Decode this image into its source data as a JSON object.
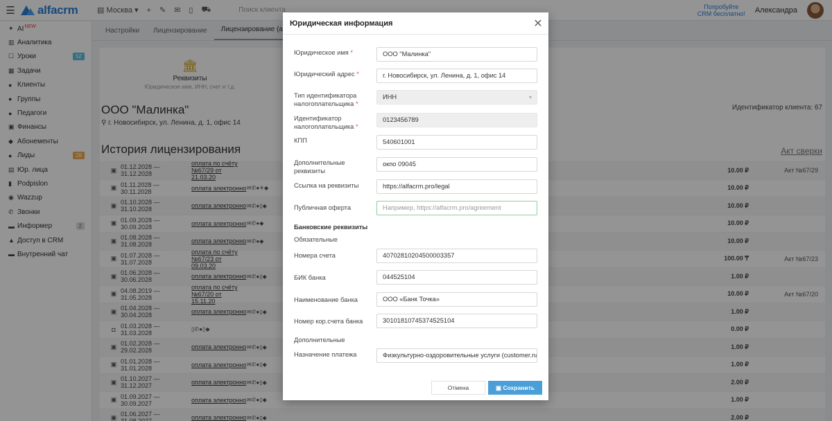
{
  "topbar": {
    "logo": "alfacrm",
    "city": "Москва",
    "search_placeholder": "Поиск клиента",
    "promo_line1": "Попробуйте",
    "promo_line2": "CRM бесплатно!",
    "user_name": "Александра"
  },
  "sidebar": {
    "items": [
      {
        "icon": "ai-icon",
        "label": "AI",
        "badge": "NEW"
      },
      {
        "icon": "analytics-icon",
        "label": "Аналитика"
      },
      {
        "icon": "lessons-icon",
        "label": "Уроки",
        "badge": "52"
      },
      {
        "icon": "tasks-icon",
        "label": "Задачи"
      },
      {
        "icon": "clients-icon",
        "label": "Клиенты"
      },
      {
        "icon": "groups-icon",
        "label": "Группы"
      },
      {
        "icon": "teachers-icon",
        "label": "Педагоги"
      },
      {
        "icon": "finance-icon",
        "label": "Финансы"
      },
      {
        "icon": "subscriptions-icon",
        "label": "Абонементы"
      },
      {
        "icon": "leads-icon",
        "label": "Лиды",
        "badge": "28"
      },
      {
        "icon": "legal-icon",
        "label": "Юр. лица"
      },
      {
        "icon": "podpislon-icon",
        "label": "Podpislon"
      },
      {
        "icon": "wazzup-icon",
        "label": "Wazzup"
      },
      {
        "icon": "calls-icon",
        "label": "Звонки"
      },
      {
        "icon": "informer-icon",
        "label": "Информер",
        "badge": "2"
      },
      {
        "icon": "lock-icon",
        "label": "Доступ в CRM"
      },
      {
        "icon": "chat-icon",
        "label": "Внутренний чат"
      }
    ]
  },
  "tabs": [
    "Настройки",
    "Лицензирование",
    "Лицензирование (архив)"
  ],
  "requisites": {
    "title": "Реквизиты",
    "subtitle": "Юридическое имя, ИНН, счет и т.д."
  },
  "org": {
    "name": "ООО \"Малинка\"",
    "address": "г. Новосибирск, ул. Ленина, д. 1, офис 14",
    "client_id": "Идентификатор клиента: 67"
  },
  "history": {
    "title": "История лицензирования",
    "act_link": "Акт сверки",
    "rows": [
      {
        "period": "01.12.2028 — 31.12.2028",
        "pay": "оплата по счёту №67/29 от 21.03.20",
        "amount": "10.00 ₽",
        "act": "Акт №67/29"
      },
      {
        "period": "01.11.2028 — 30.11.2028",
        "pay": "оплата электронно",
        "amount": "10.00 ₽",
        "act": ""
      },
      {
        "period": "01.10.2028 — 31.10.2028",
        "pay": "оплата электронно",
        "amount": "10.00 ₽",
        "act": ""
      },
      {
        "period": "01.09.2028 — 30.09.2028",
        "pay": "оплата электронно",
        "amount": "10.00 ₽",
        "act": ""
      },
      {
        "period": "01.08.2028 — 31.08.2028",
        "pay": "оплата электронно",
        "amount": "10.00 ₽",
        "act": ""
      },
      {
        "period": "01.07.2028 — 31.07.2028",
        "pay": "оплата по счёту №67/23 от 09.03.20",
        "amount": "100.00 ₸",
        "act": "Акт №67/23"
      },
      {
        "period": "01.06.2028 — 30.06.2028",
        "pay": "оплата электронно",
        "amount": "1.00 ₽",
        "act": ""
      },
      {
        "period": "04.08.2019 — 31.05.2028",
        "pay": "оплата по счёту №67/20 от 15.11.20",
        "amount": "10.00 ₽",
        "act": "Акт №67/20"
      },
      {
        "period": "01.04.2028 — 30.04.2028",
        "pay": "оплата электронно",
        "amount": "1.00 ₽",
        "act": ""
      },
      {
        "period": "01.03.2028 — 31.03.2028",
        "pay": "",
        "amount": "0.00 ₽",
        "act": ""
      },
      {
        "period": "01.02.2028 — 29.02.2028",
        "pay": "оплата электронно",
        "amount": "1.00 ₽",
        "act": ""
      },
      {
        "period": "01.01.2028 — 31.01.2028",
        "pay": "оплата электронно",
        "amount": "1.00 ₽",
        "act": ""
      },
      {
        "period": "01.10.2027 — 31.12.2027",
        "pay": "оплата электронно",
        "amount": "2.00 ₽",
        "act": ""
      },
      {
        "period": "01.09.2027 — 30.09.2027",
        "pay": "оплата электронно",
        "amount": "1.00 ₽",
        "act": ""
      },
      {
        "period": "01.06.2027 — 31.08.2027",
        "pay": "оплата электронно",
        "amount": "2.00 ₽",
        "act": ""
      }
    ]
  },
  "modal": {
    "title": "Юридическая информация",
    "fields": {
      "legal_name": {
        "label": "Юридическое имя",
        "value": "ООО \"Малинка\""
      },
      "legal_address": {
        "label": "Юридический адрес",
        "value": "г. Новосибирск, ул. Ленина, д. 1, офис 14"
      },
      "tax_id_type": {
        "label1": "Тип идентификатора",
        "label2": "налогоплательщика",
        "value": "ИНН"
      },
      "tax_id": {
        "label1": "Идентификатор",
        "label2": "налогоплательщика",
        "value": "0123456789"
      },
      "kpp": {
        "label": "КПП",
        "value": "540601001"
      },
      "extra": {
        "label1": "Дополнительные",
        "label2": "реквизиты",
        "value": "окпо 09045"
      },
      "req_link": {
        "label": "Ссылка на реквизиты",
        "value": "https://alfacrm.pro/legal"
      },
      "offer": {
        "label": "Публичная оферта",
        "placeholder": "Например, https://alfacrm.pro/agreement"
      },
      "account": {
        "label": "Номера счета",
        "value": "40702810204500003357"
      },
      "bik": {
        "label": "БИК банка",
        "value": "044525104"
      },
      "bank_name": {
        "label": "Наименование банка",
        "value": "ООО «Банк Точка»"
      },
      "corr": {
        "label": "Номер кор.счета банка",
        "value": "30101810745374525104"
      },
      "purpose": {
        "label": "Назначение платежа",
        "value": "Физкультурно-оздоровительные услуги (customer.na"
      }
    },
    "bank_section": "Банковские реквизиты",
    "required_sub": "Обязательные",
    "additional_sub": "Дополнительные",
    "cancel": "Отмена",
    "save": "Сохранить"
  }
}
